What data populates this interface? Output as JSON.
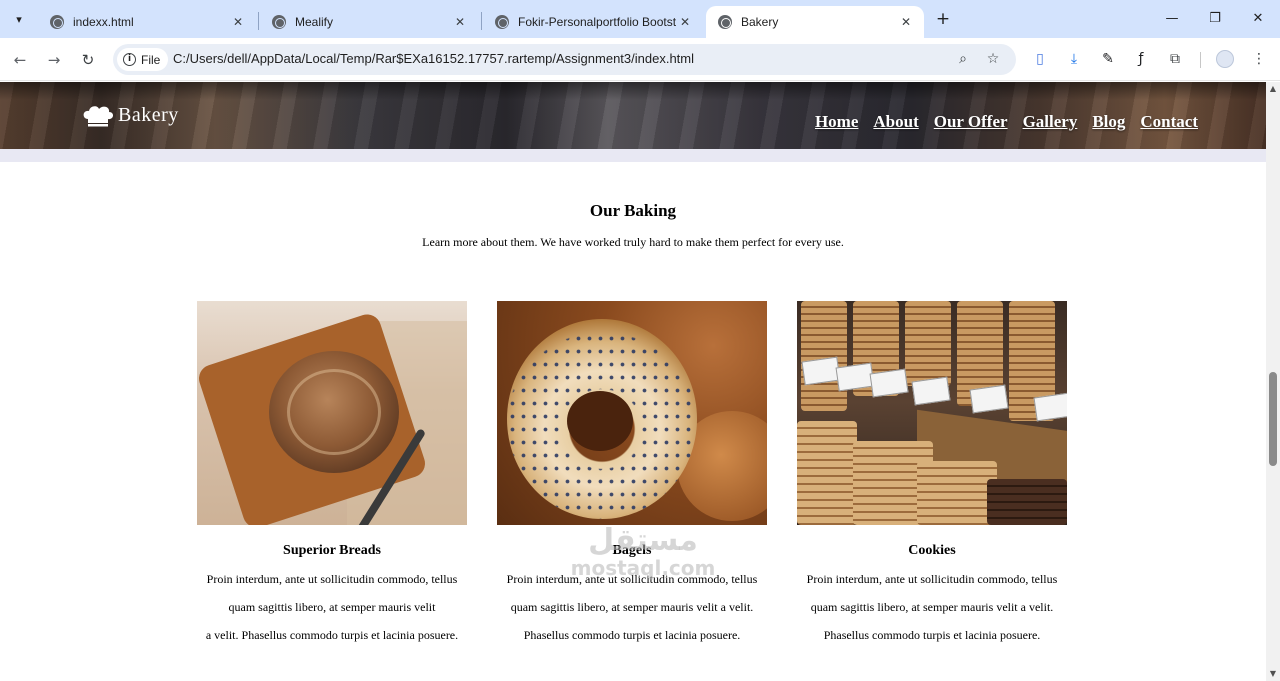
{
  "browser": {
    "tabs": [
      {
        "title": "indexx.html",
        "active": false
      },
      {
        "title": "Mealify",
        "active": false
      },
      {
        "title": "Fokir-Personalportfolio Bootst",
        "active": false
      },
      {
        "title": "Bakery",
        "active": true
      }
    ],
    "address": {
      "chip_label": "File",
      "url": "C:/Users/dell/AppData/Local/Temp/Rar$EXa16152.17757.rartemp/Assignment3/index.html"
    }
  },
  "site": {
    "logo_text": "Bakery",
    "nav": [
      "Home",
      "About",
      "Our Offer",
      "Gallery",
      "Blog",
      "Contact"
    ]
  },
  "section": {
    "title": "Our Baking",
    "subtitle": "Learn more about them. We have worked truly hard to make them perfect for every use."
  },
  "cards": [
    {
      "name": "Superior Breads",
      "lines": [
        "Proin interdum, ante ut sollicitudin commodo, tellus",
        "quam sagittis libero, at semper mauris velit",
        "a velit. Phasellus commodo turpis et lacinia posuere."
      ]
    },
    {
      "name": "Bagels",
      "lines": [
        "Proin interdum, ante ut sollicitudin commodo, tellus",
        "quam sagittis libero, at semper mauris velit a velit.",
        "Phasellus commodo turpis et lacinia posuere."
      ]
    },
    {
      "name": "Cookies",
      "lines": [
        "Proin interdum, ante ut sollicitudin commodo, tellus",
        "quam sagittis libero, at semper mauris velit a velit.",
        "Phasellus commodo turpis et lacinia posuere."
      ]
    }
  ],
  "watermark": {
    "arabic": "مستقل",
    "latin": "mostaql.com"
  }
}
